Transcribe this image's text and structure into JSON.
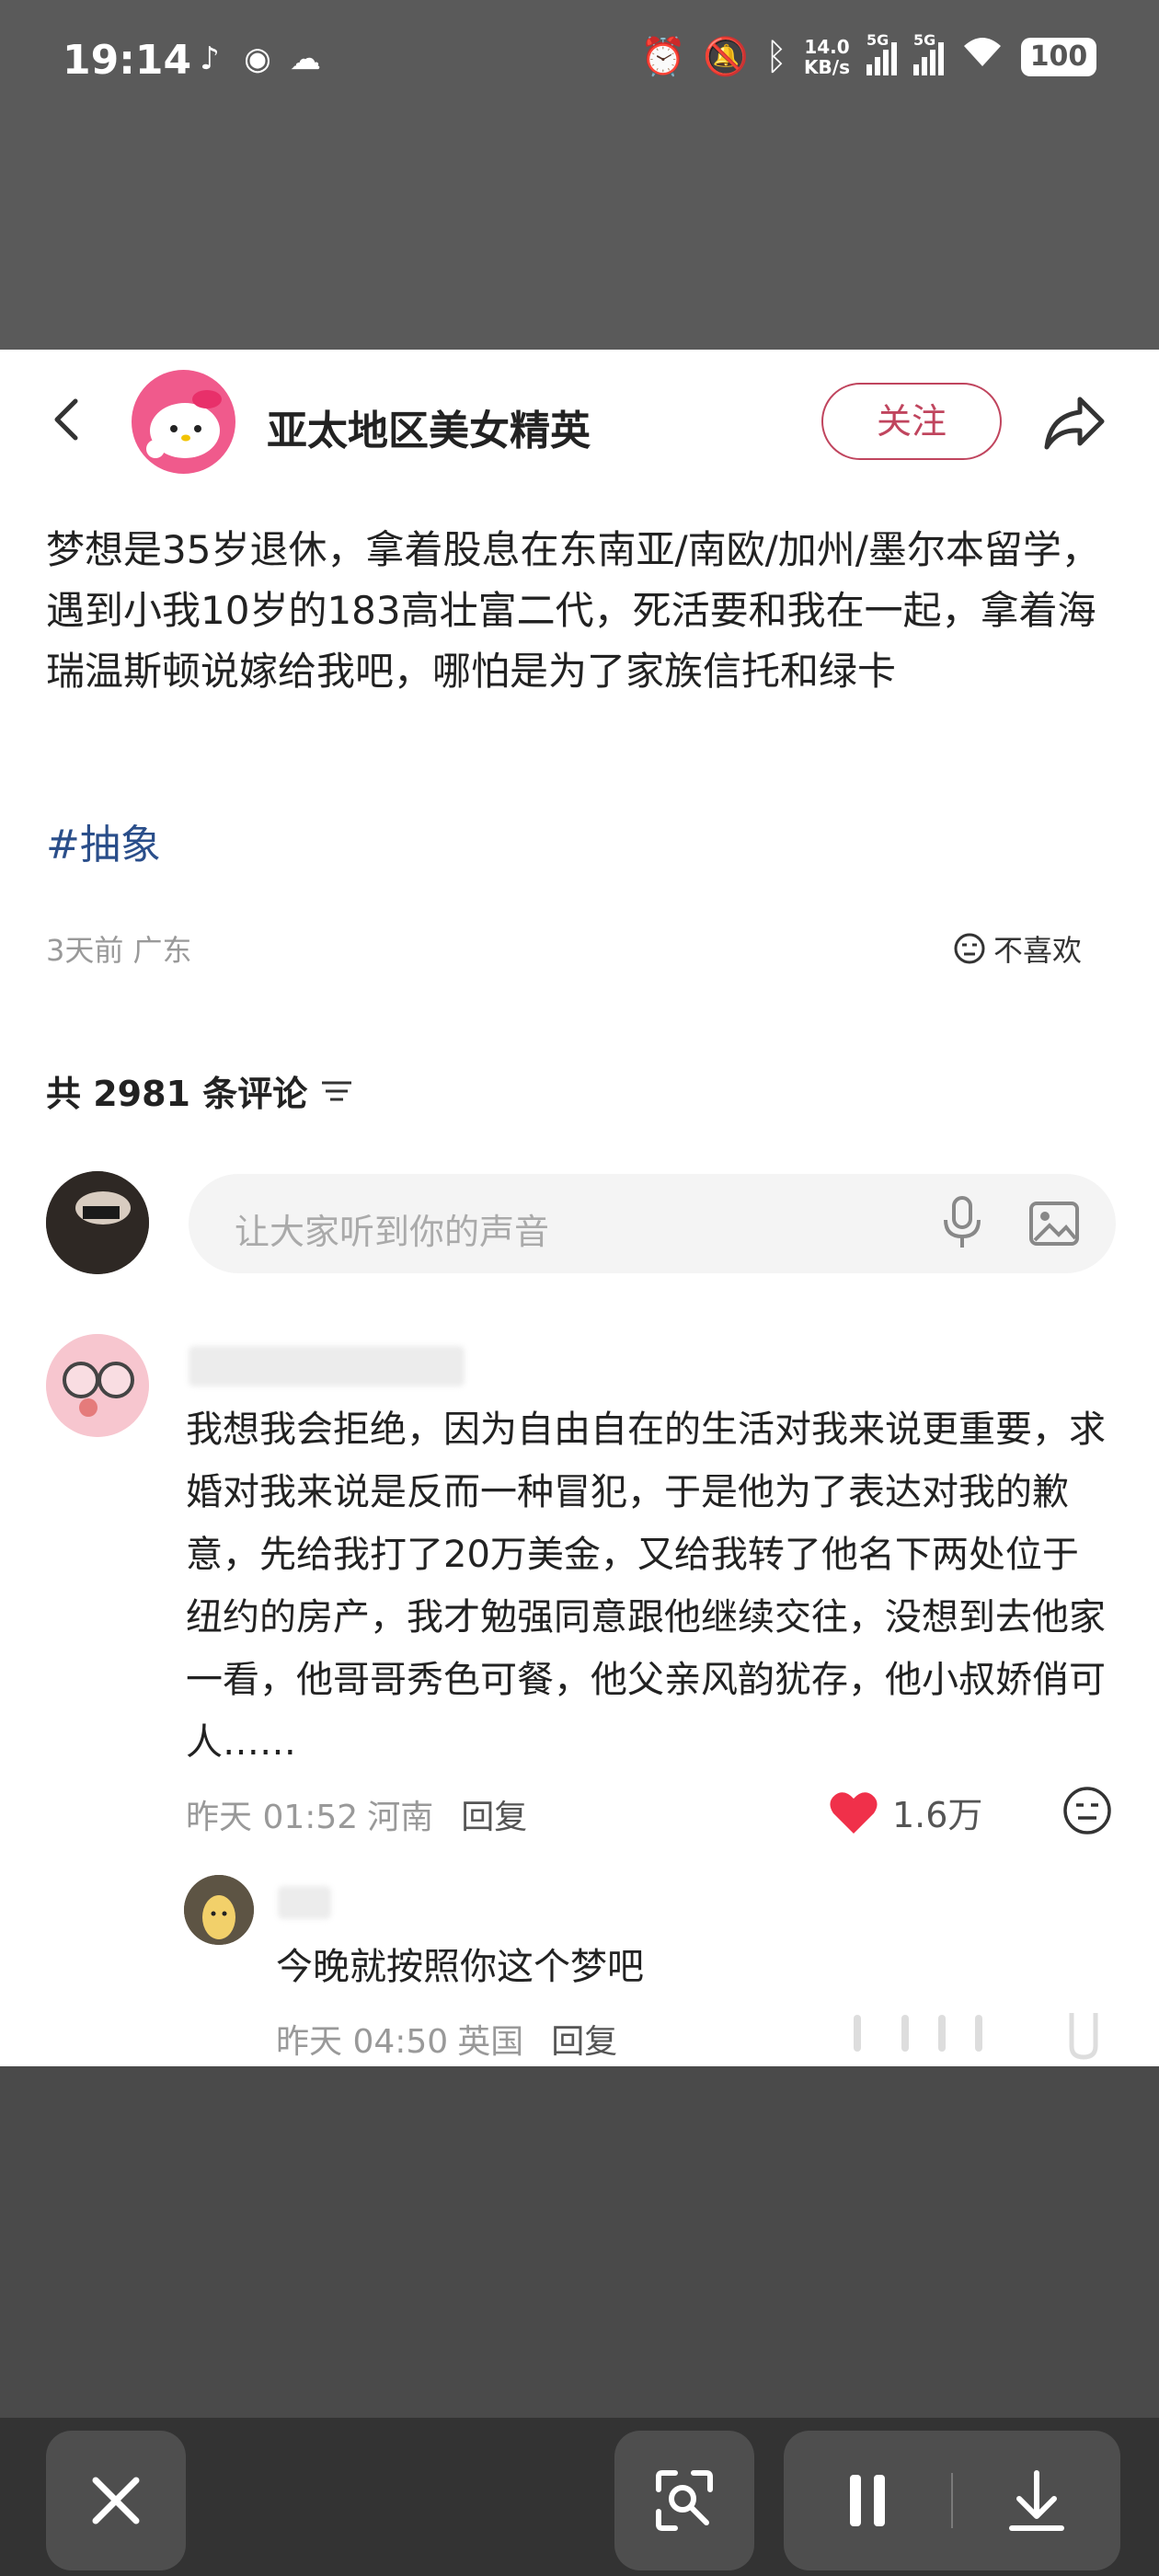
{
  "status_bar": {
    "time": "19:14",
    "net_speed_value": "14.0",
    "net_speed_unit": "KB/s",
    "signal1_label": "5G",
    "signal2_label": "5G",
    "battery": "100"
  },
  "post": {
    "author": "亚太地区美女精英",
    "follow_label": "关注",
    "text": "梦想是35岁退休，拿着股息在东南亚/南欧/加州/墨尔本留学，遇到小我10岁的183高壮富二代，死活要和我在一起，拿着海瑞温斯顿说嫁给我吧，哪怕是为了家族信托和绿卡",
    "hashtag": "#抽象",
    "meta": "3天前 广东",
    "dislike_label": "不喜欢"
  },
  "comments_section": {
    "header": "共 2981 条评论",
    "input_placeholder": "让大家听到你的声音"
  },
  "comments": [
    {
      "text": "我想我会拒绝，因为自由自在的生活对我来说更重要，求婚对我来说是反而一种冒犯，于是他为了表达对我的歉意，先给我打了20万美金，又给我转了他名下两处位于纽约的房产，我才勉强同意跟他继续交往，没想到去他家一看，他哥哥秀色可餐，他父亲风韵犹存，他小叔娇俏可人……",
      "time": "昨天 01:52",
      "location": "河南",
      "reply_label": "回复",
      "likes": "1.6万"
    },
    {
      "text": "今晚就按照你这个梦吧",
      "time": "昨天 04:50",
      "location": "英国",
      "reply_label": "回复"
    }
  ]
}
